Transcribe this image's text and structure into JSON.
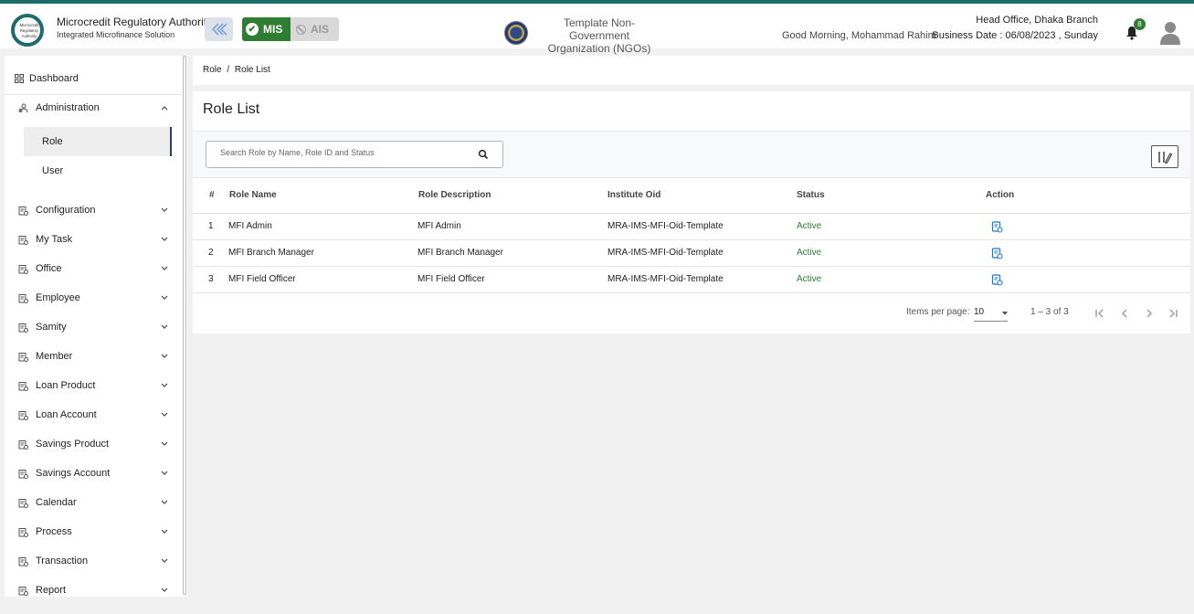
{
  "header": {
    "logo_text": "Microcredit Regulatory Authority",
    "brand_title": "Microcredit Regulatory Authority",
    "brand_subtitle": "Integrated Microfinance Solution",
    "mis_label": "MIS",
    "ais_label": "AIS",
    "org_name_line1": "Template Non-Government",
    "org_name_line2": "Organization (NGOs)",
    "greeting": "Good Morning, Mohammad Rahim",
    "branch": "Head Office, Dhaka Branch",
    "business_date": "Business Date : 06/08/2023 , Sunday",
    "notification_count": "8"
  },
  "sidebar": {
    "dashboard": "Dashboard",
    "administration": "Administration",
    "sub_items": [
      "Role",
      "User"
    ],
    "items": [
      {
        "label": "Configuration",
        "icon": "sliders-icon"
      },
      {
        "label": "My Task",
        "icon": "task-icon"
      },
      {
        "label": "Office",
        "icon": "office-icon"
      },
      {
        "label": "Employee",
        "icon": "employee-icon"
      },
      {
        "label": "Samity",
        "icon": "samity-icon"
      },
      {
        "label": "Member",
        "icon": "member-icon"
      },
      {
        "label": "Loan Product",
        "icon": "loan-product-icon"
      },
      {
        "label": "Loan Account",
        "icon": "loan-account-icon"
      },
      {
        "label": "Savings Product",
        "icon": "savings-product-icon"
      },
      {
        "label": "Savings Account",
        "icon": "savings-account-icon"
      },
      {
        "label": "Calendar",
        "icon": "calendar-icon"
      },
      {
        "label": "Process",
        "icon": "process-icon"
      },
      {
        "label": "Transaction",
        "icon": "transaction-icon"
      },
      {
        "label": "Report",
        "icon": "report-icon"
      }
    ]
  },
  "breadcrumb": {
    "root": "Role",
    "separator": "/",
    "current": "Role List"
  },
  "page": {
    "title": "Role List"
  },
  "search": {
    "placeholder": "Search Role by Name, Role ID and Status"
  },
  "table": {
    "columns": [
      "#",
      "Role Name",
      "Role Description",
      "Institute Oid",
      "Status",
      "Action"
    ],
    "rows": [
      {
        "num": "1",
        "name": "MFI Admin",
        "description": "MFI Admin",
        "oid": "MRA-IMS-MFI-Oid-Template",
        "status": "Active"
      },
      {
        "num": "2",
        "name": "MFI Branch Manager",
        "description": "MFI Branch Manager",
        "oid": "MRA-IMS-MFI-Oid-Template",
        "status": "Active"
      },
      {
        "num": "3",
        "name": "MFI Field Officer",
        "description": "MFI Field Officer",
        "oid": "MRA-IMS-MFI-Oid-Template",
        "status": "Active"
      }
    ]
  },
  "paginator": {
    "items_per_page_label": "Items per page:",
    "page_size": "10",
    "range": "1 – 3 of 3"
  },
  "colors": {
    "brand_green": "#2e7d32",
    "status_active": "#2e7d32",
    "top_stripe": "#1f6b6b",
    "action_icon": "#1976d2"
  }
}
